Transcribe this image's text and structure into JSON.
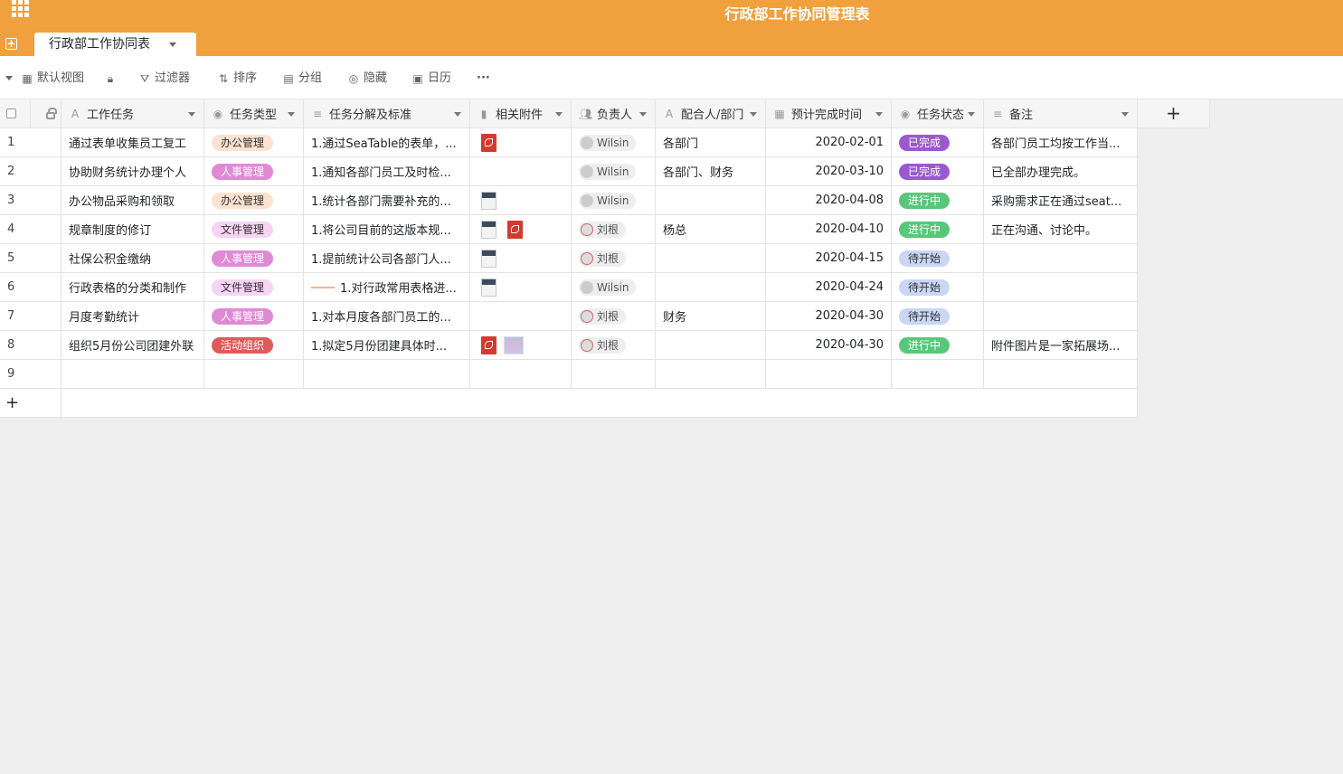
{
  "app": {
    "title": "行政部工作协同管理表",
    "tab_label": "行政部工作协同表",
    "accent": "#f0a03c"
  },
  "toolbar": {
    "view_label": "默认视图",
    "filter_label": "过滤器",
    "sort_label": "排序",
    "group_label": "分组",
    "hide_label": "隐藏",
    "calendar_label": "日历",
    "more_label": "···"
  },
  "columns": [
    {
      "key": "task",
      "label": "工作任务",
      "icon": "text-icon"
    },
    {
      "key": "type",
      "label": "任务类型",
      "icon": "single-select-icon"
    },
    {
      "key": "breakdown",
      "label": "任务分解及标准",
      "icon": "long-text-icon"
    },
    {
      "key": "attach",
      "label": "相关附件",
      "icon": "file-icon"
    },
    {
      "key": "owner",
      "label": "负责人",
      "icon": "collaborator-icon"
    },
    {
      "key": "partner",
      "label": "配合人/部门",
      "icon": "text-icon"
    },
    {
      "key": "due",
      "label": "预计完成时间",
      "icon": "date-icon"
    },
    {
      "key": "status",
      "label": "任务状态",
      "icon": "single-select-icon"
    },
    {
      "key": "notes",
      "label": "备注",
      "icon": "long-text-icon"
    }
  ],
  "type_colors": {
    "办公管理": {
      "bg": "#fde2cf",
      "fg": "#333333"
    },
    "人事管理": {
      "bg": "#e08ad6",
      "fg": "#ffffff"
    },
    "文件管理": {
      "bg": "#f7d3f5",
      "fg": "#333333"
    },
    "活动组织": {
      "bg": "#e05a5a",
      "fg": "#ffffff"
    }
  },
  "status_colors": {
    "已完成": {
      "bg": "#9b59d0",
      "fg": "#ffffff"
    },
    "进行中": {
      "bg": "#59c77a",
      "fg": "#ffffff"
    },
    "待开始": {
      "bg": "#c9d6f5",
      "fg": "#333333"
    }
  },
  "rows": [
    {
      "n": "1",
      "task": "通过表单收集员工复工",
      "type": "办公管理",
      "breakdown": "1.通过SeaTable的表单，...",
      "files": [
        "pdf"
      ],
      "owner": "Wilsin",
      "partner": "各部门",
      "due": "2020-02-01",
      "status": "已完成",
      "notes": "各部门员工均按工作当..."
    },
    {
      "n": "2",
      "task": "协助财务统计办理个人",
      "type": "人事管理",
      "breakdown": "1.通知各部门员工及时检...",
      "files": [],
      "owner": "Wilsin",
      "partner": "各部门、财务",
      "due": "2020-03-10",
      "status": "已完成",
      "notes": "已全部办理完成。"
    },
    {
      "n": "3",
      "task": "办公物品采购和领取",
      "type": "办公管理",
      "breakdown": "1.统计各部门需要补充的...",
      "files": [
        "doc"
      ],
      "owner": "Wilsin",
      "partner": "",
      "due": "2020-04-08",
      "status": "进行中",
      "notes": "采购需求正在通过seat..."
    },
    {
      "n": "4",
      "task": "规章制度的修订",
      "type": "文件管理",
      "breakdown": "1.将公司目前的这版本规...",
      "files": [
        "doc",
        "pdf"
      ],
      "owner": "刘根",
      "partner": "杨总",
      "due": "2020-04-10",
      "status": "进行中",
      "notes": "正在沟通、讨论中。"
    },
    {
      "n": "5",
      "task": "社保公积金缴纳",
      "type": "人事管理",
      "breakdown": "1.提前统计公司各部门人...",
      "files": [
        "doc"
      ],
      "owner": "刘根",
      "partner": "",
      "due": "2020-04-15",
      "status": "待开始",
      "notes": ""
    },
    {
      "n": "6",
      "task": "行政表格的分类和制作",
      "type": "文件管理",
      "breakdown": "1.对行政常用表格进...",
      "files": [
        "doc"
      ],
      "owner": "Wilsin",
      "partner": "",
      "due": "2020-04-24",
      "status": "待开始",
      "notes": ""
    },
    {
      "n": "7",
      "task": "月度考勤统计",
      "type": "人事管理",
      "breakdown": "1.对本月度各部门员工的...",
      "files": [],
      "owner": "刘根",
      "partner": "财务",
      "due": "2020-04-30",
      "status": "待开始",
      "notes": ""
    },
    {
      "n": "8",
      "task": "组织5月份公司团建外联",
      "type": "活动组织",
      "breakdown": "1.拟定5月份团建具体时...",
      "files": [
        "pdf",
        "img"
      ],
      "owner": "刘根",
      "partner": "",
      "due": "2020-04-30",
      "status": "进行中",
      "notes": "附件图片是一家拓展场..."
    },
    {
      "n": "9",
      "task": "",
      "type": "",
      "breakdown": "",
      "files": [],
      "owner": "",
      "partner": "",
      "due": "",
      "status": "",
      "notes": ""
    }
  ],
  "add_row_label": "+",
  "add_column_label": "+"
}
